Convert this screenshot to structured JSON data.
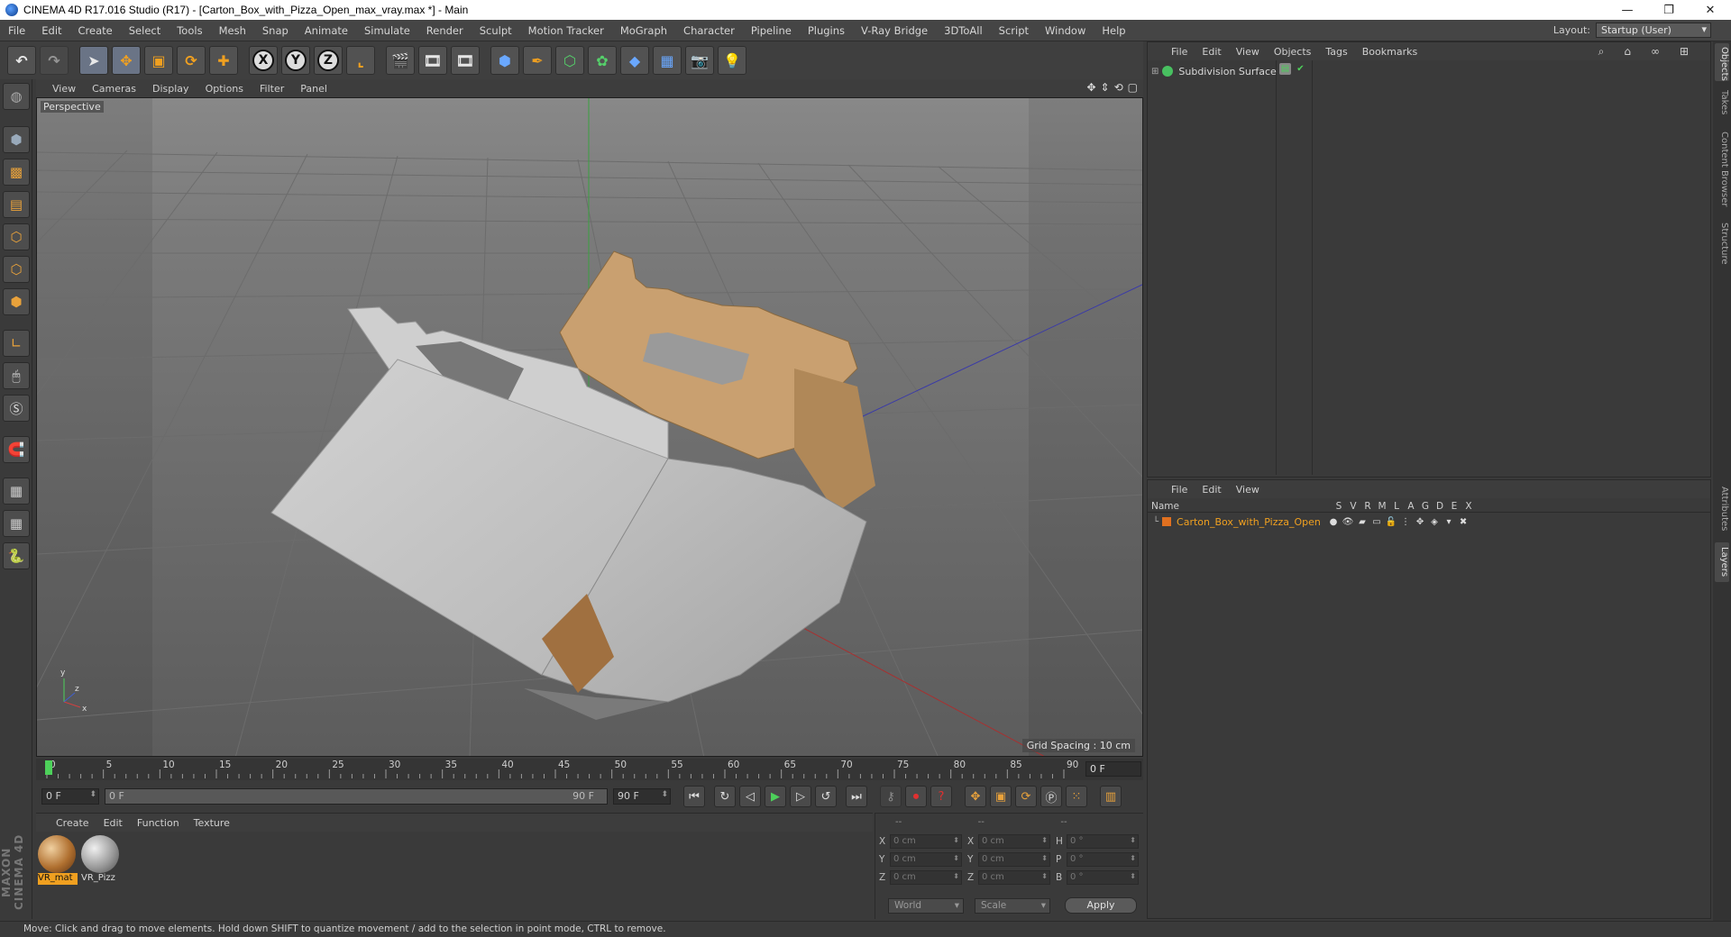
{
  "window": {
    "title": "CINEMA 4D R17.016 Studio (R17) - [Carton_Box_with_Pizza_Open_max_vray.max *] - Main",
    "controls": [
      "—",
      "❐",
      "✕"
    ]
  },
  "menu": [
    "File",
    "Edit",
    "Create",
    "Select",
    "Tools",
    "Mesh",
    "Snap",
    "Animate",
    "Simulate",
    "Render",
    "Sculpt",
    "Motion Tracker",
    "MoGraph",
    "Character",
    "Pipeline",
    "Plugins",
    "V-Ray Bridge",
    "3DToAll",
    "Script",
    "Window",
    "Help"
  ],
  "layout": {
    "label": "Layout:",
    "value": "Startup (User)"
  },
  "toolbar": {
    "axis_x": "X",
    "axis_y": "Y",
    "axis_z": "Z"
  },
  "viewport": {
    "menu": [
      "View",
      "Cameras",
      "Display",
      "Options",
      "Filter",
      "Panel"
    ],
    "label": "Perspective",
    "grid_spacing": "Grid Spacing : 10 cm"
  },
  "timeline": {
    "ticks": [
      "0",
      "5",
      "10",
      "15",
      "20",
      "25",
      "30",
      "35",
      "40",
      "45",
      "50",
      "55",
      "60",
      "65",
      "70",
      "75",
      "80",
      "85",
      "90"
    ],
    "current_frame": "0 F",
    "start_field": "0 F",
    "range_start": "0 F",
    "range_end": "90 F",
    "end_field": "90 F"
  },
  "material_manager": {
    "menu": [
      "Create",
      "Edit",
      "Function",
      "Texture"
    ],
    "materials": [
      {
        "label": "VR_mat",
        "color": "#b07030"
      },
      {
        "label": "VR_Pizz",
        "color": "#9a9a9a"
      }
    ]
  },
  "coordinates": {
    "headers": [
      "--",
      "--",
      "--"
    ],
    "rows": [
      {
        "a1": "X",
        "v1": "0 cm",
        "a2": "X",
        "v2": "0 cm",
        "a3": "H",
        "v3": "0 °"
      },
      {
        "a1": "Y",
        "v1": "0 cm",
        "a2": "Y",
        "v2": "0 cm",
        "a3": "P",
        "v3": "0 °"
      },
      {
        "a1": "Z",
        "v1": "0 cm",
        "a2": "Z",
        "v2": "0 cm",
        "a3": "B",
        "v3": "0 °"
      }
    ],
    "space": "World",
    "mode": "Scale",
    "apply": "Apply"
  },
  "object_manager": {
    "menu": [
      "File",
      "Edit",
      "View",
      "Objects",
      "Tags",
      "Bookmarks"
    ],
    "objects": [
      {
        "name": "Subdivision Surface"
      }
    ]
  },
  "layer_manager": {
    "menu": [
      "File",
      "Edit",
      "View"
    ],
    "header_name": "Name",
    "columns": [
      "S",
      "V",
      "R",
      "M",
      "L",
      "A",
      "G",
      "D",
      "E",
      "X"
    ],
    "layers": [
      {
        "name": "Carton_Box_with_Pizza_Open",
        "color": "#e07020"
      }
    ]
  },
  "side_tabs": [
    "Objects",
    "Takes",
    "Content Browser",
    "Structure",
    "Attributes",
    "Layers"
  ],
  "maxon_logo": "MAXON CINEMA 4D",
  "status": "Move: Click and drag to move elements. Hold down SHIFT to quantize movement / add to the selection in point mode, CTRL to remove."
}
